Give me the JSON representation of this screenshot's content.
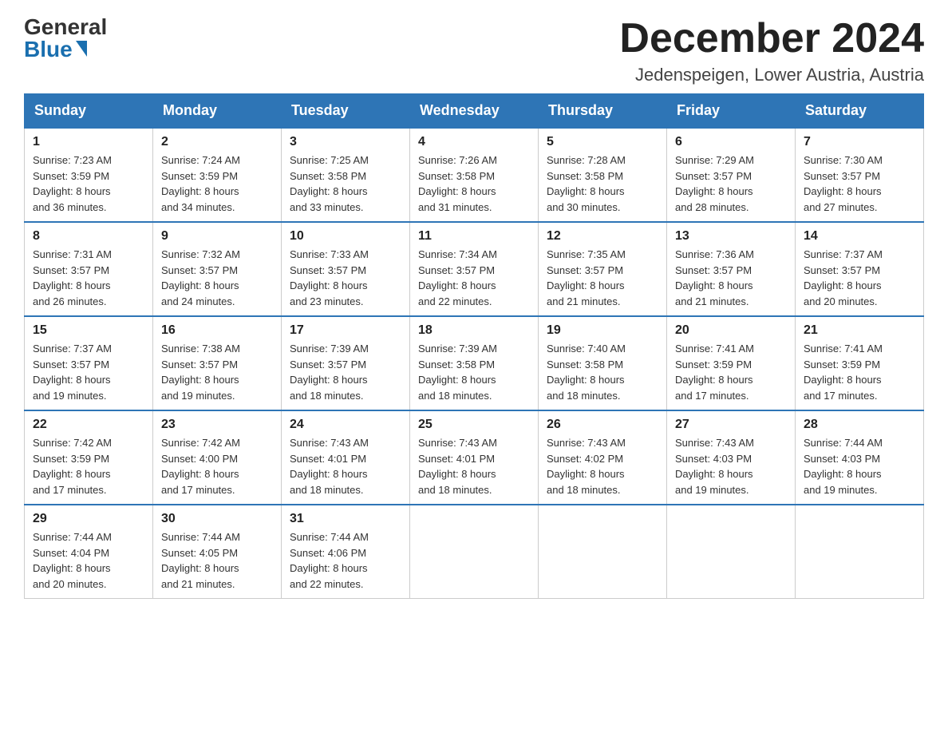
{
  "header": {
    "logo_general": "General",
    "logo_blue": "Blue",
    "month_title": "December 2024",
    "location": "Jedenspeigen, Lower Austria, Austria"
  },
  "days_of_week": [
    "Sunday",
    "Monday",
    "Tuesday",
    "Wednesday",
    "Thursday",
    "Friday",
    "Saturday"
  ],
  "weeks": [
    [
      {
        "day": "1",
        "sunrise": "7:23 AM",
        "sunset": "3:59 PM",
        "daylight": "8 hours and 36 minutes."
      },
      {
        "day": "2",
        "sunrise": "7:24 AM",
        "sunset": "3:59 PM",
        "daylight": "8 hours and 34 minutes."
      },
      {
        "day": "3",
        "sunrise": "7:25 AM",
        "sunset": "3:58 PM",
        "daylight": "8 hours and 33 minutes."
      },
      {
        "day": "4",
        "sunrise": "7:26 AM",
        "sunset": "3:58 PM",
        "daylight": "8 hours and 31 minutes."
      },
      {
        "day": "5",
        "sunrise": "7:28 AM",
        "sunset": "3:58 PM",
        "daylight": "8 hours and 30 minutes."
      },
      {
        "day": "6",
        "sunrise": "7:29 AM",
        "sunset": "3:57 PM",
        "daylight": "8 hours and 28 minutes."
      },
      {
        "day": "7",
        "sunrise": "7:30 AM",
        "sunset": "3:57 PM",
        "daylight": "8 hours and 27 minutes."
      }
    ],
    [
      {
        "day": "8",
        "sunrise": "7:31 AM",
        "sunset": "3:57 PM",
        "daylight": "8 hours and 26 minutes."
      },
      {
        "day": "9",
        "sunrise": "7:32 AM",
        "sunset": "3:57 PM",
        "daylight": "8 hours and 24 minutes."
      },
      {
        "day": "10",
        "sunrise": "7:33 AM",
        "sunset": "3:57 PM",
        "daylight": "8 hours and 23 minutes."
      },
      {
        "day": "11",
        "sunrise": "7:34 AM",
        "sunset": "3:57 PM",
        "daylight": "8 hours and 22 minutes."
      },
      {
        "day": "12",
        "sunrise": "7:35 AM",
        "sunset": "3:57 PM",
        "daylight": "8 hours and 21 minutes."
      },
      {
        "day": "13",
        "sunrise": "7:36 AM",
        "sunset": "3:57 PM",
        "daylight": "8 hours and 21 minutes."
      },
      {
        "day": "14",
        "sunrise": "7:37 AM",
        "sunset": "3:57 PM",
        "daylight": "8 hours and 20 minutes."
      }
    ],
    [
      {
        "day": "15",
        "sunrise": "7:37 AM",
        "sunset": "3:57 PM",
        "daylight": "8 hours and 19 minutes."
      },
      {
        "day": "16",
        "sunrise": "7:38 AM",
        "sunset": "3:57 PM",
        "daylight": "8 hours and 19 minutes."
      },
      {
        "day": "17",
        "sunrise": "7:39 AM",
        "sunset": "3:57 PM",
        "daylight": "8 hours and 18 minutes."
      },
      {
        "day": "18",
        "sunrise": "7:39 AM",
        "sunset": "3:58 PM",
        "daylight": "8 hours and 18 minutes."
      },
      {
        "day": "19",
        "sunrise": "7:40 AM",
        "sunset": "3:58 PM",
        "daylight": "8 hours and 18 minutes."
      },
      {
        "day": "20",
        "sunrise": "7:41 AM",
        "sunset": "3:59 PM",
        "daylight": "8 hours and 17 minutes."
      },
      {
        "day": "21",
        "sunrise": "7:41 AM",
        "sunset": "3:59 PM",
        "daylight": "8 hours and 17 minutes."
      }
    ],
    [
      {
        "day": "22",
        "sunrise": "7:42 AM",
        "sunset": "3:59 PM",
        "daylight": "8 hours and 17 minutes."
      },
      {
        "day": "23",
        "sunrise": "7:42 AM",
        "sunset": "4:00 PM",
        "daylight": "8 hours and 17 minutes."
      },
      {
        "day": "24",
        "sunrise": "7:43 AM",
        "sunset": "4:01 PM",
        "daylight": "8 hours and 18 minutes."
      },
      {
        "day": "25",
        "sunrise": "7:43 AM",
        "sunset": "4:01 PM",
        "daylight": "8 hours and 18 minutes."
      },
      {
        "day": "26",
        "sunrise": "7:43 AM",
        "sunset": "4:02 PM",
        "daylight": "8 hours and 18 minutes."
      },
      {
        "day": "27",
        "sunrise": "7:43 AM",
        "sunset": "4:03 PM",
        "daylight": "8 hours and 19 minutes."
      },
      {
        "day": "28",
        "sunrise": "7:44 AM",
        "sunset": "4:03 PM",
        "daylight": "8 hours and 19 minutes."
      }
    ],
    [
      {
        "day": "29",
        "sunrise": "7:44 AM",
        "sunset": "4:04 PM",
        "daylight": "8 hours and 20 minutes."
      },
      {
        "day": "30",
        "sunrise": "7:44 AM",
        "sunset": "4:05 PM",
        "daylight": "8 hours and 21 minutes."
      },
      {
        "day": "31",
        "sunrise": "7:44 AM",
        "sunset": "4:06 PM",
        "daylight": "8 hours and 22 minutes."
      },
      null,
      null,
      null,
      null
    ]
  ],
  "labels": {
    "sunrise": "Sunrise:",
    "sunset": "Sunset:",
    "daylight": "Daylight:"
  }
}
